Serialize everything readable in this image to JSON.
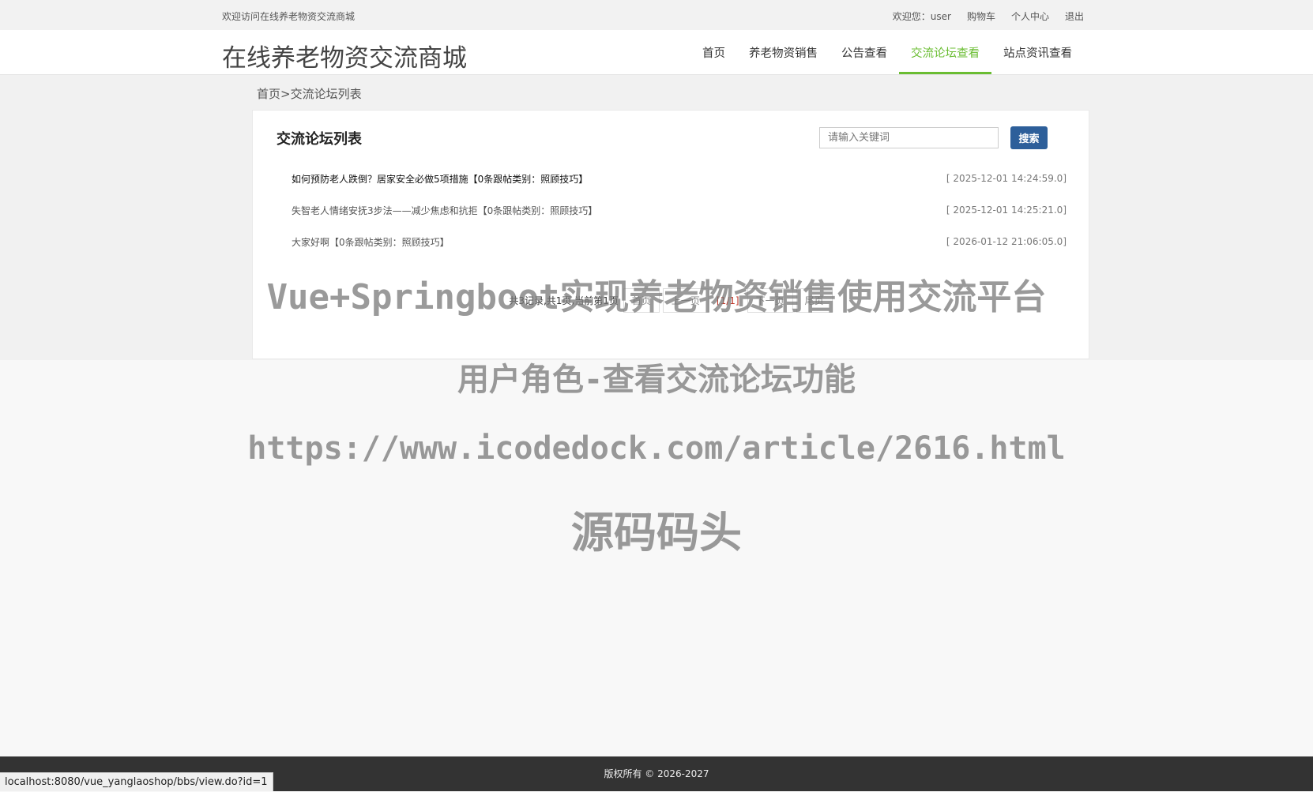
{
  "topbar": {
    "welcome": "欢迎访问在线养老物资交流商城",
    "user_greeting": "欢迎您：user",
    "cart": "购物车",
    "profile": "个人中心",
    "logout": "退出"
  },
  "header": {
    "logo": "在线养老物资交流商城",
    "nav": [
      {
        "label": "首页",
        "active": false
      },
      {
        "label": "养老物资销售",
        "active": false
      },
      {
        "label": "公告查看",
        "active": false
      },
      {
        "label": "交流论坛查看",
        "active": true
      },
      {
        "label": "站点资讯查看",
        "active": false
      }
    ],
    "accent_color": "#6abd32"
  },
  "breadcrumb": {
    "home": "首页",
    "separator": ">",
    "current": "交流论坛列表"
  },
  "panel": {
    "title": "交流论坛列表",
    "search": {
      "placeholder": "请输入关键词",
      "value": "",
      "button_label": "搜索",
      "button_color": "#2d5f9a"
    },
    "posts": [
      {
        "title": "如何预防老人跌倒？居家安全必做5项措施【0条跟帖类别：照顾技巧】",
        "date": "[ 2025-12-01 14:24:59.0]"
      },
      {
        "title": "失智老人情绪安抚3步法——减少焦虑和抗拒【0条跟帖类别：照顾技巧】",
        "date": "[ 2025-12-01 14:25:21.0]"
      },
      {
        "title": "大家好啊【0条跟帖类别：照顾技巧】",
        "date": "[ 2026-01-12 21:06:05.0]"
      }
    ],
    "pagination": {
      "info": "共3记录,共1页,当前第1页",
      "first": "首页",
      "prev": "上一页",
      "current": "[1/1]",
      "next": "下一页",
      "last": "尾页"
    }
  },
  "watermark": {
    "line1": "Vue+Springboot实现养老物资销售使用交流平台",
    "line2": "用户角色-查看交流论坛功能",
    "line3": "https://www.icodedock.com/article/2616.html",
    "line4": "源码码头"
  },
  "footer": {
    "copyright": "版权所有 © 2026-2027"
  },
  "statusbar": {
    "url": "localhost:8080/vue_yanglaoshop/bbs/view.do?id=1"
  }
}
